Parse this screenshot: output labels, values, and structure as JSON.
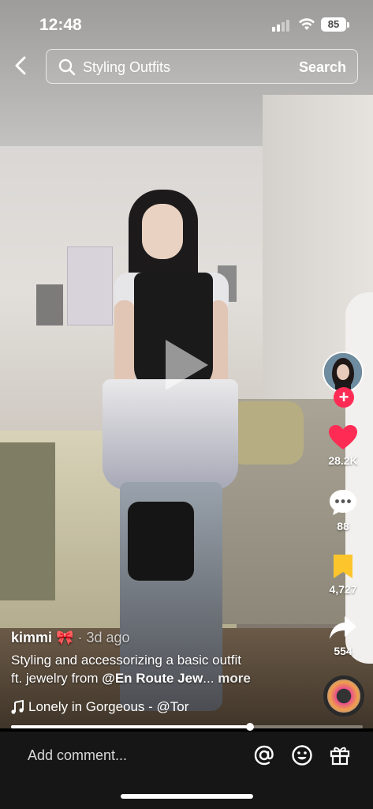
{
  "status_bar": {
    "time": "12:48",
    "battery": "85"
  },
  "search": {
    "query": "Styling Outfits",
    "button_label": "Search"
  },
  "video": {
    "progress_percent": 68
  },
  "actions": {
    "likes": "28.2K",
    "comments": "88",
    "saves": "4,727",
    "shares": "554"
  },
  "caption": {
    "author": "kimmi",
    "author_suffix": "🎀",
    "age": "· 3d ago",
    "line1": "Styling and accessorizing a basic outfit",
    "line2_prefix": "ft. jewelry from ",
    "mention": "@En Route Jew",
    "ellipsis": "...",
    "more": "more"
  },
  "music": {
    "title": "Lonely in Gorgeous - @Tor"
  },
  "comment_bar": {
    "placeholder": "Add comment..."
  },
  "colors": {
    "like_red": "#fe2c55",
    "save_yellow": "#fcc52c",
    "accent": "#fe2c55"
  }
}
